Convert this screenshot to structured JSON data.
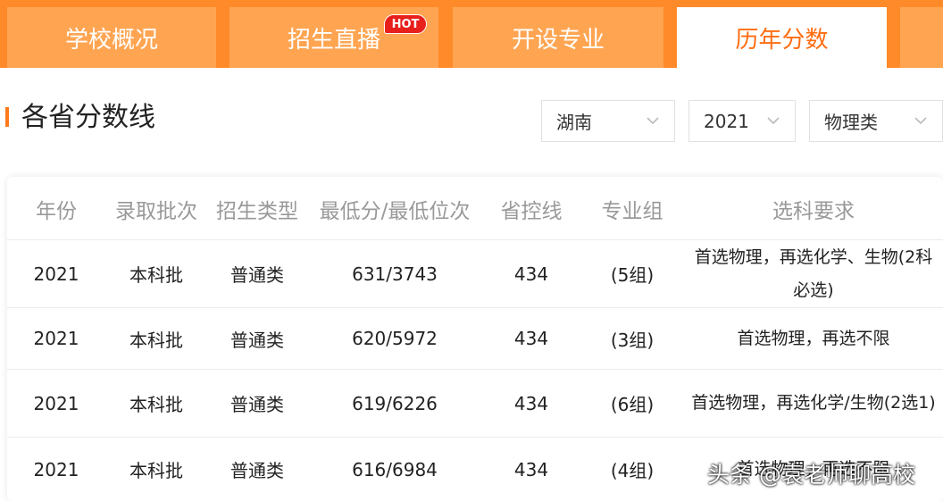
{
  "tabs": [
    {
      "label": "学校概况"
    },
    {
      "label": "招生直播",
      "badge": "HOT"
    },
    {
      "label": "开设专业"
    },
    {
      "label": "历年分数"
    }
  ],
  "section_title": "各省分数线",
  "filters": {
    "province": "湖南",
    "year": "2021",
    "subject_type": "物理类"
  },
  "table": {
    "headers": [
      "年份",
      "录取批次",
      "招生类型",
      "最低分/最低位次",
      "省控线",
      "专业组",
      "选科要求"
    ],
    "rows": [
      [
        "2021",
        "本科批",
        "普通类",
        "631/3743",
        "434",
        "(5组)",
        "首选物理，再选化学、生物(2科必选)"
      ],
      [
        "2021",
        "本科批",
        "普通类",
        "620/5972",
        "434",
        "(3组)",
        "首选物理，再选不限"
      ],
      [
        "2021",
        "本科批",
        "普通类",
        "619/6226",
        "434",
        "(6组)",
        "首选物理，再选化学/生物(2选1)"
      ],
      [
        "2021",
        "本科批",
        "普通类",
        "616/6984",
        "434",
        "(4组)",
        "首选物理，再选不限"
      ]
    ]
  },
  "watermark": "头条 @袁老师聊高校",
  "colors": {
    "accent": "#ff8a2a",
    "tab": "#ffa552",
    "active_text": "#ff6d12",
    "badge": "#e8201c"
  }
}
